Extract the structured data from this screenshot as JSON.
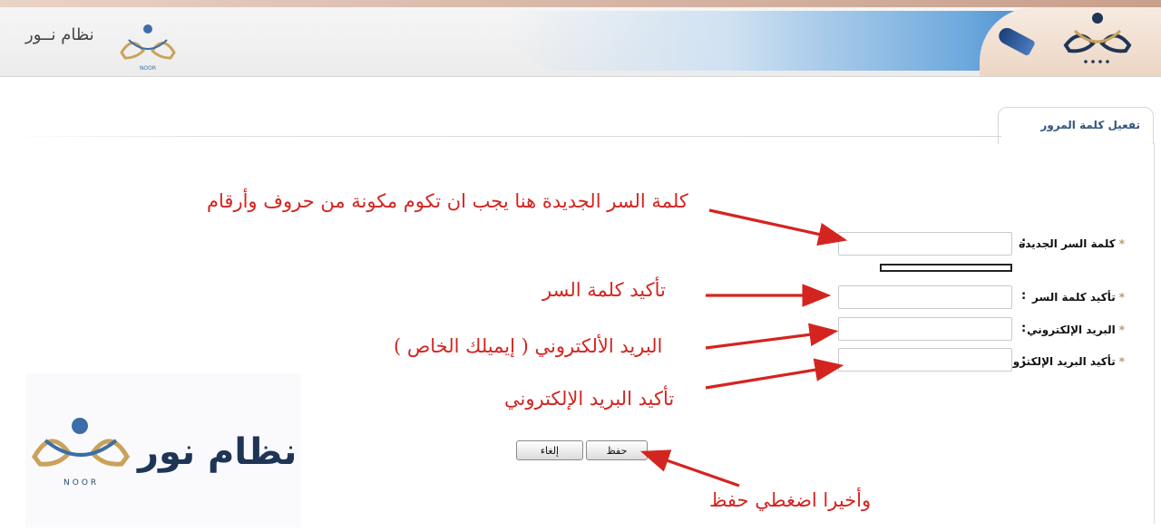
{
  "header": {
    "brand_text": "نظام نــور",
    "logo_caption_left": "NOOR"
  },
  "tab": {
    "label": "تفعيل كلمة المرور"
  },
  "form": {
    "new_password_label": "كلمة السر الجديدة",
    "confirm_password_label": "تأكيد كلمة السر",
    "email_label": "البريد الإلكتروني",
    "confirm_email_label": "تأكيد البريد الإلكتروني",
    "colon": ":",
    "required_mark": "*",
    "save_label": "حفظ",
    "cancel_label": "إلغاء"
  },
  "annotations": {
    "new_password_note": "كلمة السر الجديدة هنا يجب ان تكوم مكونة من حروف وأرقام",
    "confirm_password_note": "تأكيد كلمة السر",
    "email_note": "البريد الألكتروني ( إيميلك الخاص )",
    "confirm_email_note": "تأكيد البريد الإلكتروني",
    "save_note": "وأخيرا اضغطي حفظ"
  },
  "watermark": {
    "title": "نظام نور",
    "subtitle": "NOOR"
  },
  "colors": {
    "annotation_red": "#d42420",
    "brand_navy": "#1e3556",
    "brand_gold": "#c9a25a",
    "header_blue": "#3f86cc"
  }
}
